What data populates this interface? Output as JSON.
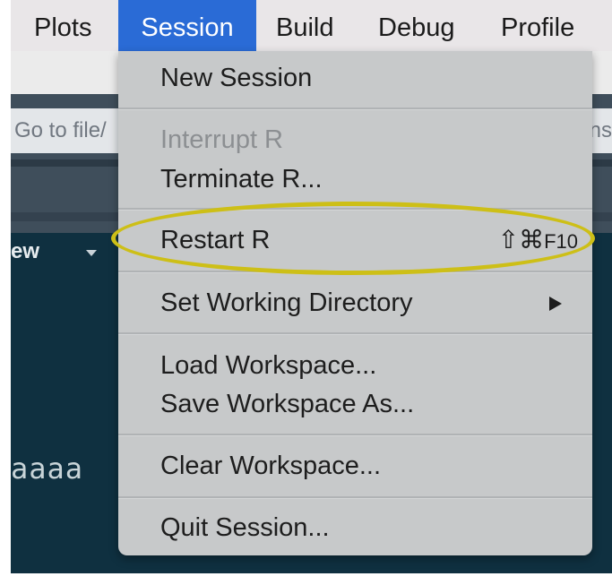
{
  "menubar": {
    "items": [
      {
        "label": "Plots"
      },
      {
        "label": "Session"
      },
      {
        "label": "Build"
      },
      {
        "label": "Debug"
      },
      {
        "label": "Profile"
      }
    ],
    "active": "Session"
  },
  "background": {
    "goto_placeholder": "Go to file/",
    "goto_right_fragment": "ns",
    "view_label": "ew",
    "editor_text": "aaaa"
  },
  "session_menu": {
    "items": [
      {
        "label": "New Session"
      },
      {
        "label": "Interrupt R",
        "enabled": false
      },
      {
        "label": "Terminate R..."
      },
      {
        "label": "Restart R",
        "shortcut_symbols": "⇧⌘",
        "shortcut_key": "F10",
        "highlighted": true
      },
      {
        "label": "Set Working Directory",
        "submenu": true
      },
      {
        "label": "Load Workspace..."
      },
      {
        "label": "Save Workspace As..."
      },
      {
        "label": "Clear Workspace..."
      },
      {
        "label": "Quit Session..."
      }
    ]
  },
  "colors": {
    "menubar_bg": "#e9e6e8",
    "active_menu_bg": "#2a6bd6",
    "menu_bg": "#c7c9ca",
    "highlight_outline": "#cdbf17",
    "editor_bg": "#0f3040"
  }
}
